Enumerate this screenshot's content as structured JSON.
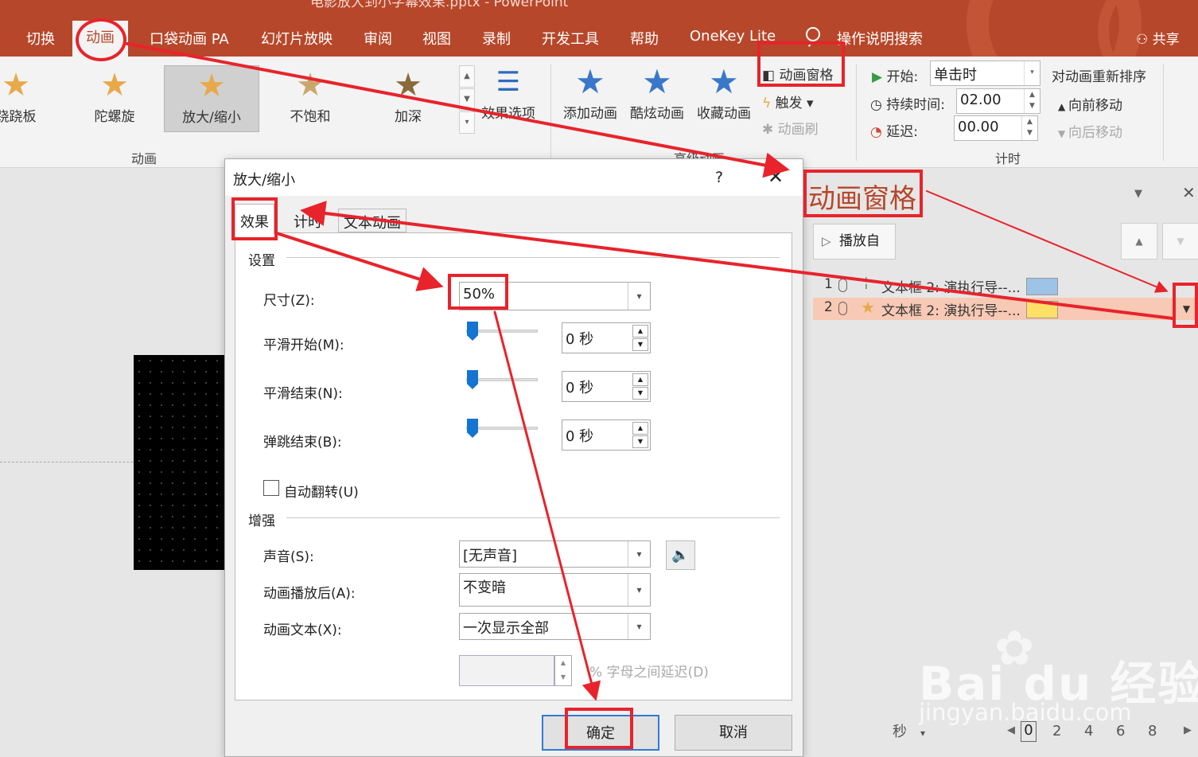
{
  "window": {
    "doc_title": "电影放大到小字幕效果.pptx - PowerPoint",
    "tabs": [
      "切换",
      "动画",
      "口袋动画 PA",
      "幻灯片放映",
      "审阅",
      "视图",
      "录制",
      "开发工具",
      "帮助",
      "OneKey Lite"
    ],
    "active_tab": "动画",
    "search_label": "操作说明搜索",
    "share_label": "共享"
  },
  "ribbon": {
    "gallery": [
      "跷跷板",
      "陀螺旋",
      "放大/缩小",
      "不饱和",
      "加深"
    ],
    "gallery_selected": "放大/缩小",
    "effect_options": "效果选项",
    "group_animation": "动画",
    "advanced": {
      "add_animation": "添加动画",
      "cool_animation": "酷炫动画",
      "fav_animation": "收藏动画",
      "anim_pane": "动画窗格",
      "trigger": "触发",
      "anim_painter": "动画刷",
      "group_label": "高级动画"
    },
    "timing": {
      "start_label": "开始:",
      "start_value": "单击时",
      "duration_label": "持续时间:",
      "duration_value": "02.00",
      "delay_label": "延迟:",
      "delay_value": "00.00",
      "reorder_title": "对动画重新排序",
      "move_earlier": "向前移动",
      "move_later": "向后移动",
      "group_label": "计时"
    }
  },
  "pane": {
    "title": "动画窗格",
    "play_label": "播放自",
    "items": [
      {
        "num": "1",
        "name": "文本框 2: 演执行导--...",
        "color": "#9dc3e6"
      },
      {
        "num": "2",
        "name": "文本框 2: 演执行导--...",
        "color": "#ffe066"
      }
    ],
    "timeline_unit": "秒",
    "timeline_ticks": [
      "0",
      "2",
      "4",
      "6",
      "8"
    ]
  },
  "dialog": {
    "title": "放大/缩小",
    "help": "?",
    "close": "✕",
    "tabs": [
      "效果",
      "计时",
      "文本动画"
    ],
    "section_settings": "设置",
    "size_label": "尺寸(Z):",
    "size_value": "50%",
    "smooth_start_label": "平滑开始(M):",
    "smooth_start_value": "0 秒",
    "smooth_end_label": "平滑结束(N):",
    "smooth_end_value": "0 秒",
    "bounce_end_label": "弹跳结束(B):",
    "bounce_end_value": "0 秒",
    "auto_reverse_label": "自动翻转(U)",
    "section_enhance": "增强",
    "sound_label": "声音(S):",
    "sound_value": "[无声音]",
    "after_anim_label": "动画播放后(A):",
    "after_anim_value": "不变暗",
    "anim_text_label": "动画文本(X):",
    "anim_text_value": "一次显示全部",
    "delay_between_label": "% 字母之间延迟(D)",
    "ok": "确定",
    "cancel": "取消"
  },
  "watermark": {
    "logo": "Bai du 经验",
    "url": "jingyan.baidu.com"
  },
  "colors": {
    "accent": "#b7472a",
    "annotation": "#e8232b"
  }
}
